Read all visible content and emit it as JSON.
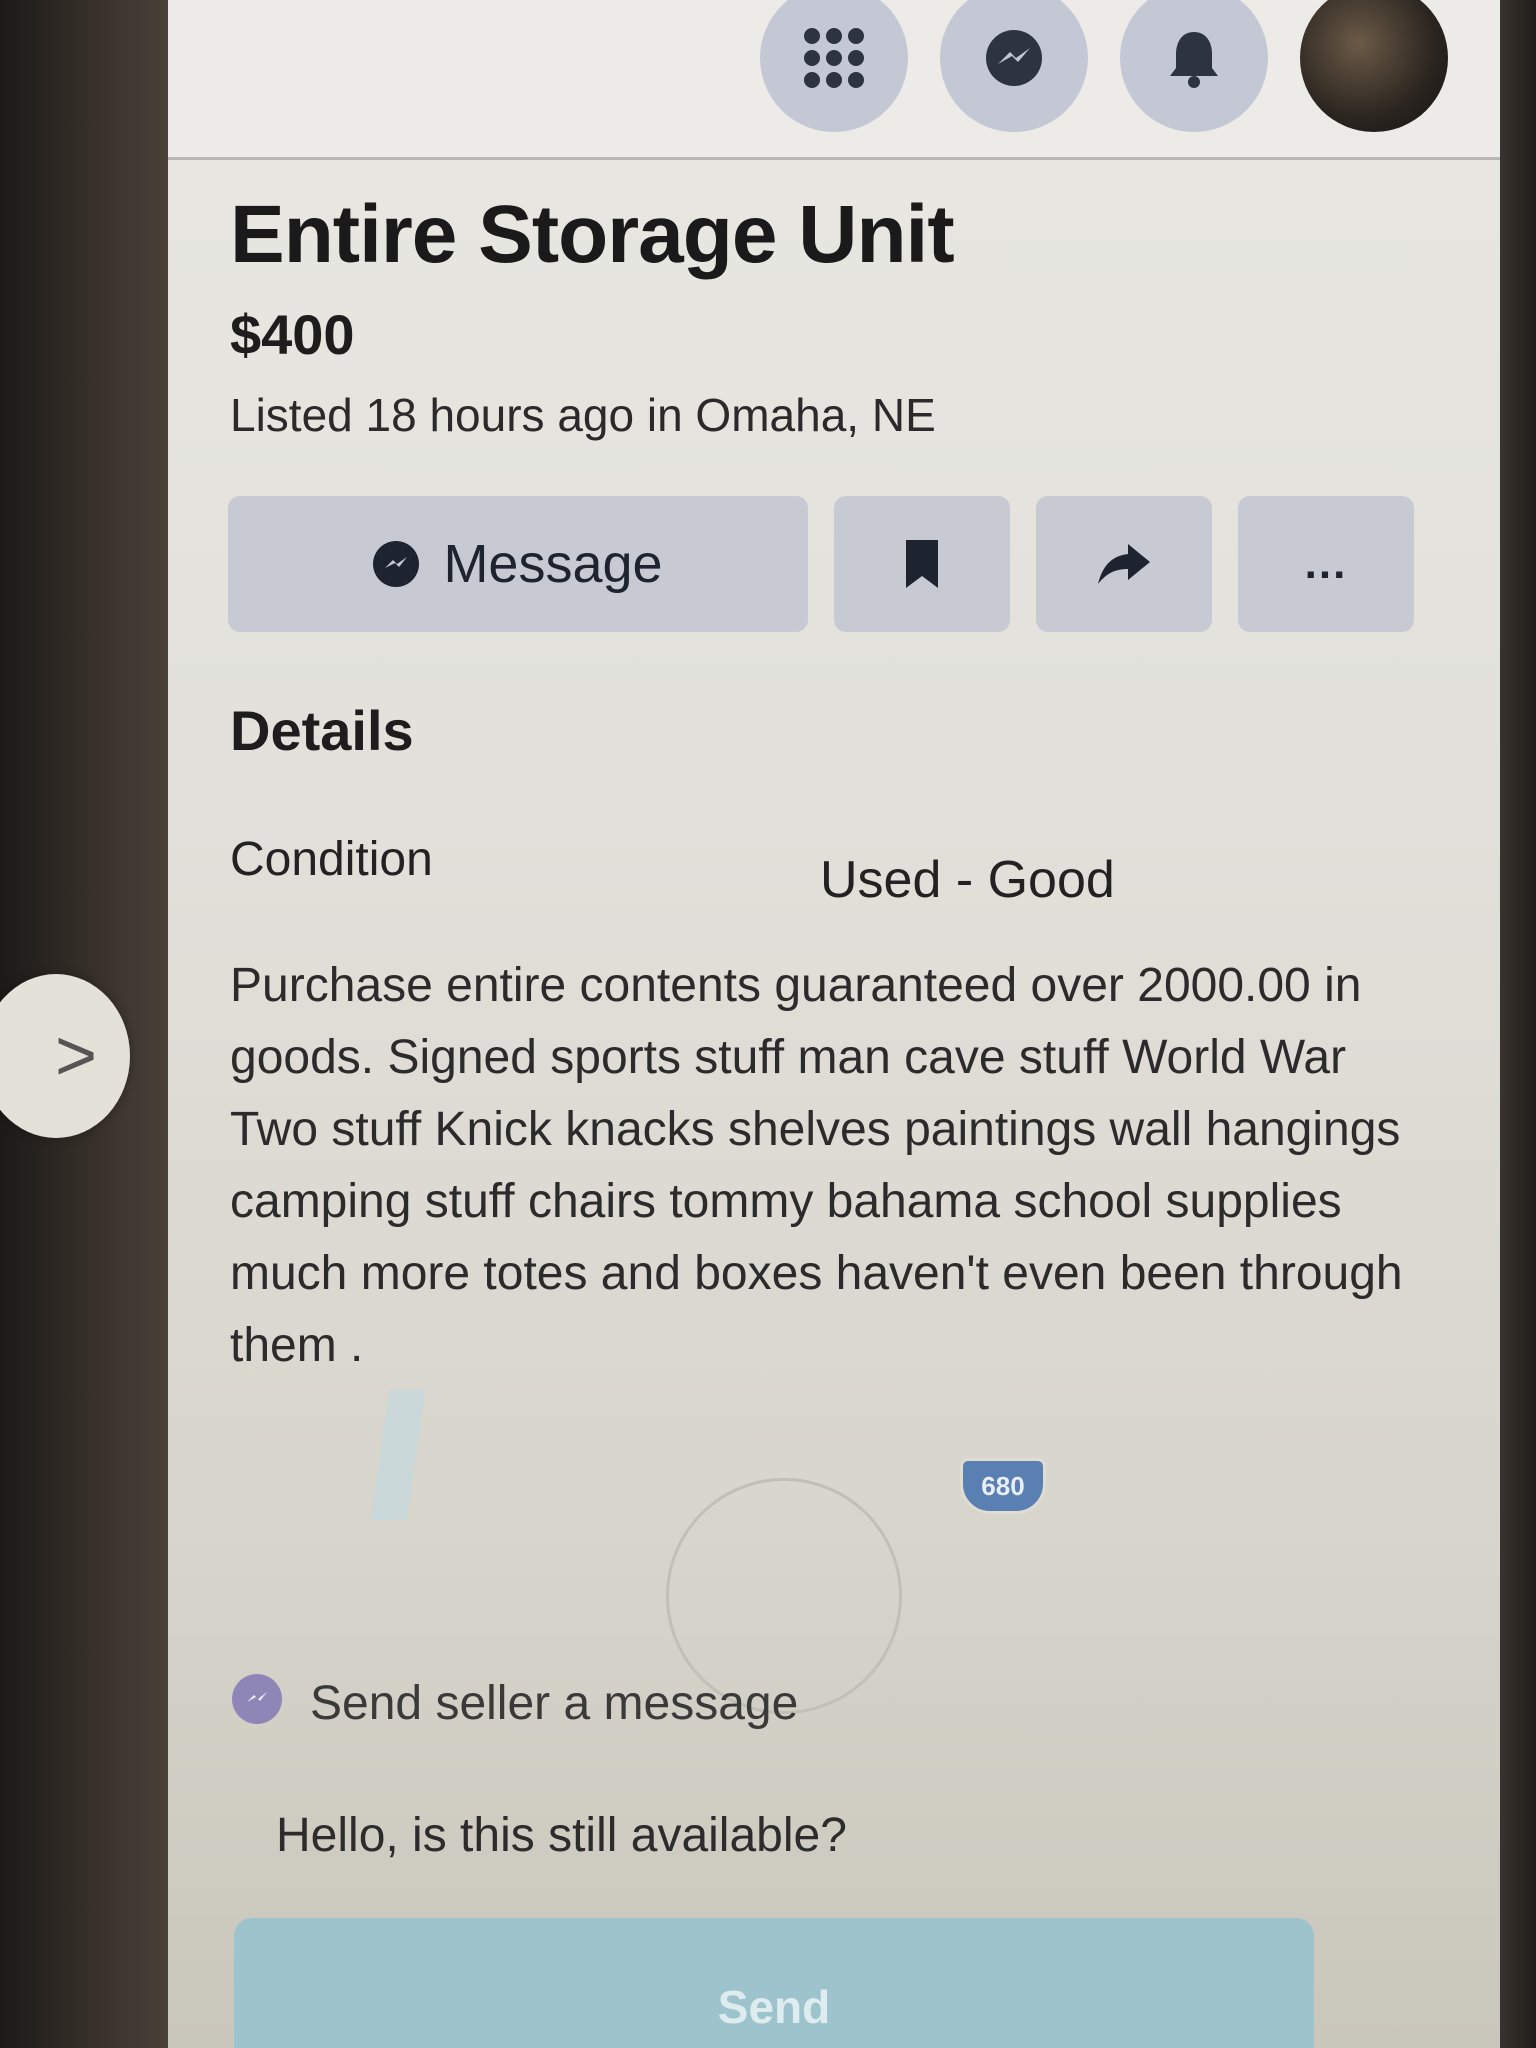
{
  "header": {
    "icons": [
      "menu-icon",
      "messenger-icon",
      "notifications-icon",
      "avatar"
    ]
  },
  "listing": {
    "title": "Entire Storage Unit",
    "price": "$400",
    "listed": "Listed 18 hours ago in Omaha, NE"
  },
  "actions": {
    "message_label": "Message",
    "more_label": "..."
  },
  "details": {
    "heading": "Details",
    "condition_label": "Condition",
    "condition_value": "Used - Good",
    "description": "Purchase entire contents guaranteed over 2000.00 in goods. Signed sports stuff man cave stuff World War Two stuff Knick knacks shelves paintings wall hangings camping stuff chairs tommy bahama school supplies much more totes and boxes haven't even been through them ."
  },
  "map": {
    "highway_shield": "680"
  },
  "message_box": {
    "label": "Send seller a message",
    "input_value": "Hello, is this still available?",
    "send_label": "Send"
  },
  "nav": {
    "next_arrow": ">"
  }
}
